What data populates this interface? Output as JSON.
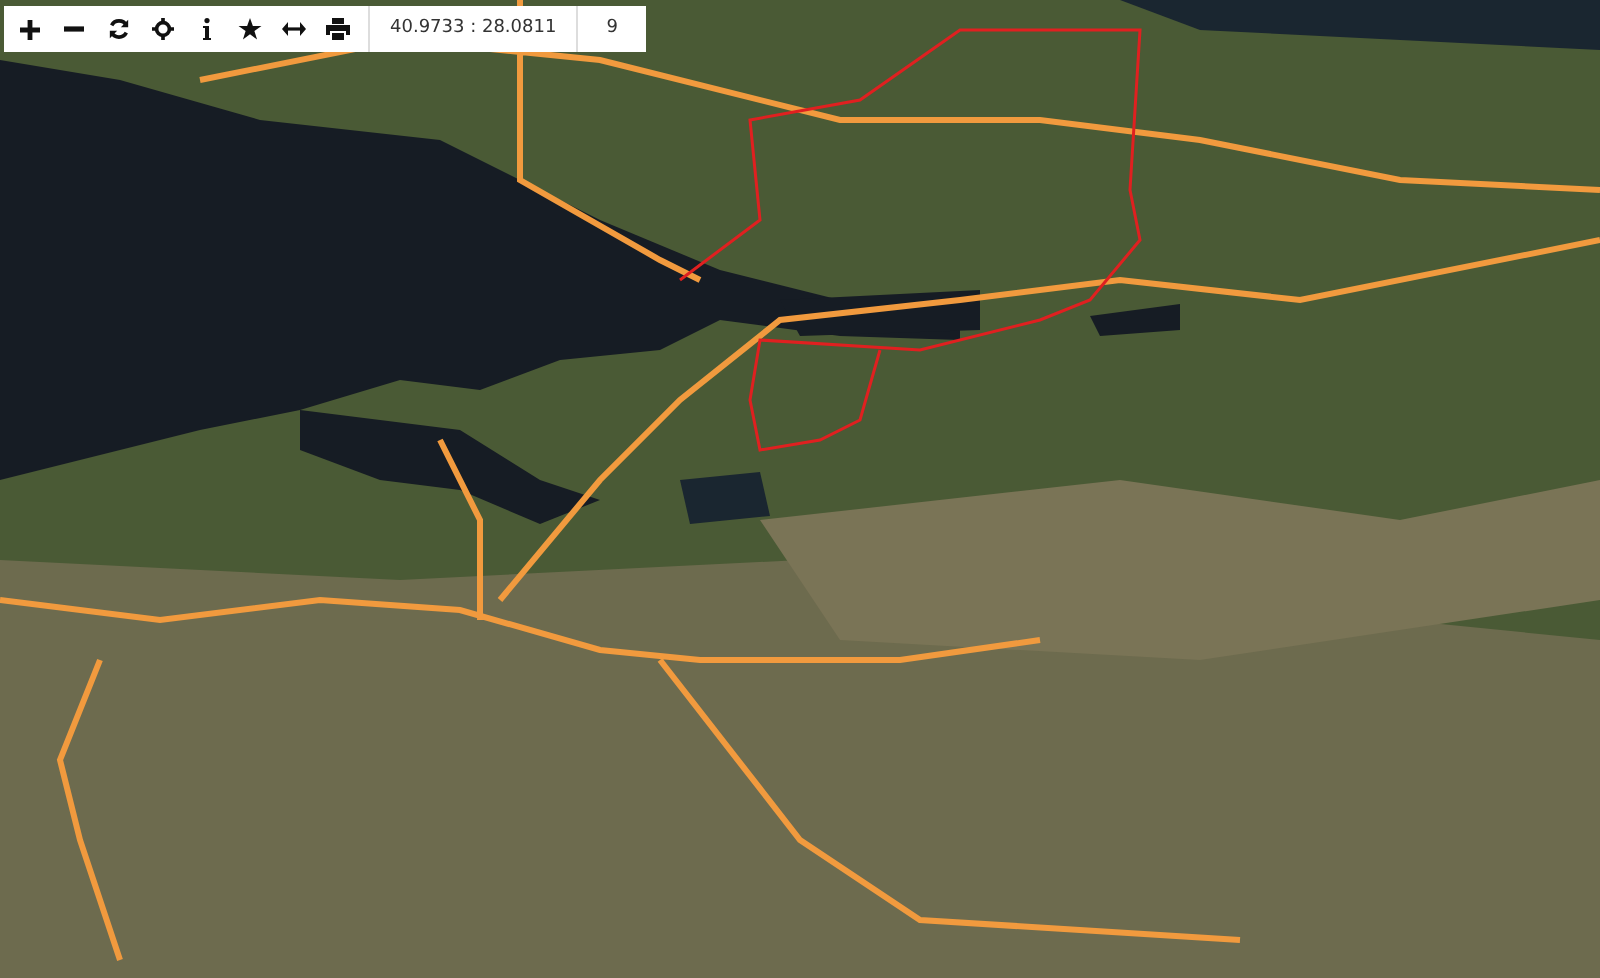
{
  "toolbar": {
    "coordinates": "40.9733 : 28.0811",
    "zoom": "9"
  }
}
